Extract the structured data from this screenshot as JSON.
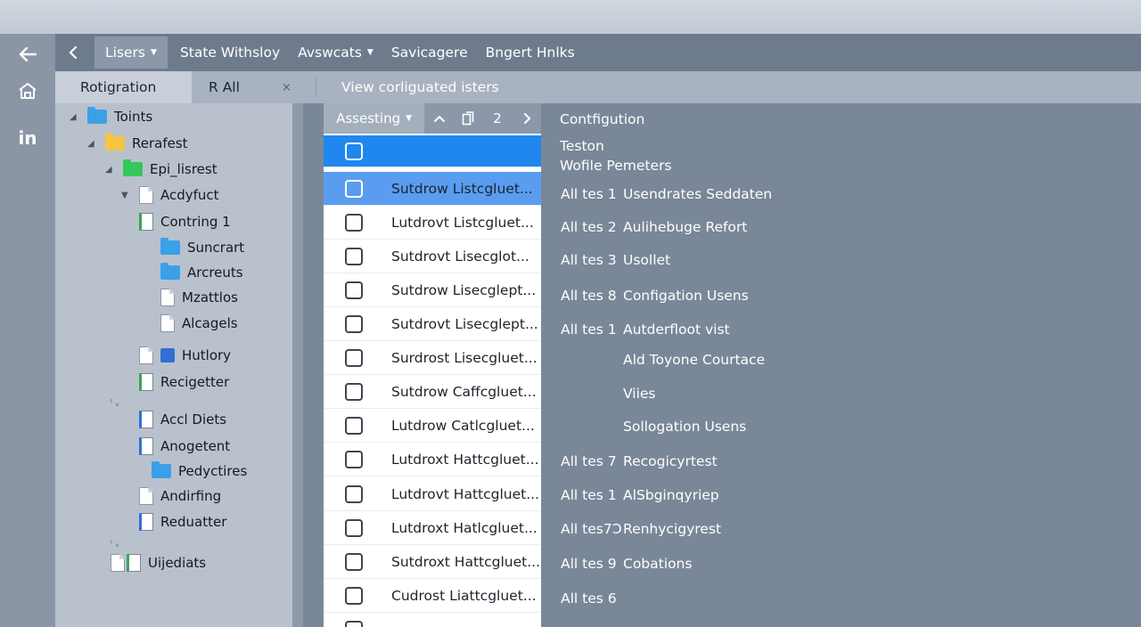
{
  "menubar": {
    "active_menu": "Lisers",
    "items": [
      "State Withsloy",
      "Avswcats",
      "Savicagere",
      "Bngert Hnlks"
    ]
  },
  "tabs": {
    "active": "Rotigration",
    "second": "R All",
    "close_glyph": "×",
    "view_link": "View corliguated isters"
  },
  "tree": {
    "items": [
      {
        "label": "Toints"
      },
      {
        "label": "Rerafest"
      },
      {
        "label": "Epi_lisrest"
      },
      {
        "label": "Acdyfuct"
      },
      {
        "label": "Contring 1"
      },
      {
        "label": "Suncrart"
      },
      {
        "label": "Arcreuts"
      },
      {
        "label": "Mzattlos"
      },
      {
        "label": "Alcagels"
      },
      {
        "label": "Hutlory"
      },
      {
        "label": "Recigetter"
      },
      {
        "label": "Accl Diets"
      },
      {
        "label": "Anogetent"
      },
      {
        "label": "Pedyctires"
      },
      {
        "label": "Andirfing"
      },
      {
        "label": "Reduatter"
      },
      {
        "label": "Uijediats"
      }
    ]
  },
  "list_toolbar": {
    "sort_label": "Assesting",
    "page_number": "2"
  },
  "list": {
    "rows": [
      {
        "label": ""
      },
      {
        "label": "Sutdrow Listcgluet..."
      },
      {
        "label": "Lutdrovt Listcgluet..."
      },
      {
        "label": "Sutdrovt Lisecglot..."
      },
      {
        "label": "Sutdrow Lisecglept..."
      },
      {
        "label": "Sutdrovt Lisecglept..."
      },
      {
        "label": "Surdrost Lisecgluet..."
      },
      {
        "label": "Sutdrow Caffcgluet..."
      },
      {
        "label": "Lutdrow Catlcgluet..."
      },
      {
        "label": "Lutdroxt Hattcgluet..."
      },
      {
        "label": "Lutdrovt Hattcgluet..."
      },
      {
        "label": "Lutdroxt Hatlcgluet..."
      },
      {
        "label": "Sutdroxt Hattcgluet..."
      },
      {
        "label": "Cudrost Liattcgluet..."
      }
    ]
  },
  "detail": {
    "header": "Contfigution",
    "subtitle_1": "Teston",
    "subtitle_2": "Wofile Pemeters",
    "rows": [
      {
        "key": "All tes 1",
        "value": "Usendrates Seddaten"
      },
      {
        "key": "All tes 2",
        "value": "Aulihebuge Refort"
      },
      {
        "key": "All tes 3",
        "value": "Usollet"
      },
      {
        "key": "All tes 8",
        "value": "Configation Usens"
      },
      {
        "key": "All tes 1",
        "value": "Autderfloot vist"
      },
      {
        "key": "",
        "value": "Ald Toyone Courtace"
      },
      {
        "key": "",
        "value": "Viies"
      },
      {
        "key": "",
        "value": "Sollogation Usens"
      },
      {
        "key": "All tes 7",
        "value": "Recogicyrtest"
      },
      {
        "key": "All tes 1",
        "value": "AlSbginqyriep"
      },
      {
        "key": "All tes7Ɔ",
        "value": "Renhycigyrest"
      },
      {
        "key": "All tes 9",
        "value": "Cobations"
      },
      {
        "key": "All tes 6",
        "value": ""
      }
    ]
  },
  "colors": {
    "selection": "#1f87ef",
    "folder_blue": "#3aa0e8",
    "folder_yellow": "#f5c542",
    "folder_green": "#34c759"
  },
  "icons": [
    "back-arrow-icon",
    "home-icon",
    "linkedin-icon",
    "chevron-left-icon",
    "chevron-up-icon",
    "copy-icon",
    "chevron-right-icon",
    "folder-icon",
    "document-icon",
    "checkbox-icon"
  ]
}
